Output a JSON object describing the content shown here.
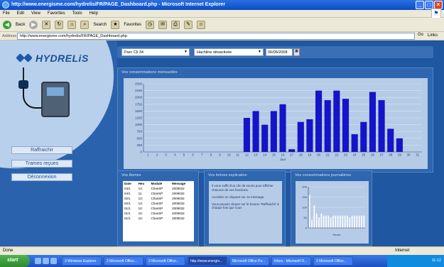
{
  "window": {
    "title": "http://www.energisme.com/hydrelis/FR/PAGE_Dashboard.php - Microsoft Internet Explorer"
  },
  "menu": [
    "File",
    "Edit",
    "View",
    "Favorites",
    "Tools",
    "Help"
  ],
  "toolbar": {
    "back": "Back",
    "search": "Search",
    "favorites": "Favorites"
  },
  "address": {
    "label": "Address",
    "url": "http://www.energisme.com/hydrelis/FR/PAGE_Dashboard.php",
    "go": "Go",
    "links": "Links"
  },
  "brand": {
    "name": "HYDRELiS"
  },
  "nav": [
    {
      "label": "Raffraichir"
    },
    {
      "label": "Trames reçues"
    },
    {
      "label": "Déconnexion"
    }
  ],
  "filters": {
    "site": "Parc Cli 34",
    "sensor": "Hachline désactivée",
    "date": "06/06/2008"
  },
  "panels": {
    "main_title": "Vos consommations mensuelles",
    "alerts_title": "Vos Alertes",
    "explain_title": "Vos brèves explication",
    "mini_title": "Vos consommations journalières"
  },
  "alerts": {
    "headers": [
      "Date",
      "Heu",
      "Module",
      "Message"
    ],
    "rows": [
      [
        "04/1",
        "13:",
        "ChanSP",
        "2009032"
      ],
      [
        "04/1",
        "11:",
        "ChanSP",
        "2009032"
      ],
      [
        "02/1",
        "13:",
        "ChanSP",
        "2009032"
      ],
      [
        "02/1",
        "13:",
        "ChanSP",
        "2009032"
      ],
      [
        "01/1",
        "10:",
        "ChanSP",
        "2009032"
      ],
      [
        "01/1",
        "10:",
        "ChanSP",
        "2009032"
      ],
      [
        "01/1",
        "10:",
        "ChanSP",
        "2009032"
      ]
    ]
  },
  "explain": {
    "paragraphs": [
      "Il vous suffit d'un clic de souris pour afficher chacune de vos fonctions.",
      "Accédez en cliquant sur ce message.",
      "Vous pouvez cliquer sur le bouton 'Raffraichir' à chaque fois que vous"
    ]
  },
  "chart_data": [
    {
      "type": "bar",
      "categories": [
        "1",
        "2",
        "3",
        "4",
        "5",
        "6",
        "7",
        "8",
        "9",
        "10",
        "11",
        "12",
        "13",
        "14",
        "15",
        "16",
        "17",
        "18",
        "19",
        "20",
        "21",
        "22",
        "23",
        "24",
        "25",
        "26",
        "27",
        "28",
        "29",
        "30",
        "31"
      ],
      "values": [
        0,
        0,
        0,
        0,
        0,
        0,
        0,
        0,
        0,
        0,
        0,
        1250,
        1500,
        1000,
        1500,
        1750,
        100,
        1100,
        1200,
        2250,
        1900,
        2250,
        1950,
        650,
        1100,
        2200,
        1900,
        850,
        500,
        0,
        0
      ],
      "ylim": [
        0,
        2500
      ],
      "yticks": [
        0,
        250,
        500,
        750,
        1000,
        1250,
        1500,
        1750,
        2000,
        2250,
        2500
      ],
      "xlabel": "Jour",
      "color": "#1414c8"
    },
    {
      "type": "bar",
      "categories": [
        "0",
        "1",
        "2",
        "3",
        "4",
        "5",
        "6",
        "7",
        "8",
        "9",
        "10",
        "11",
        "12",
        "13",
        "14",
        "15",
        "16",
        "17",
        "18",
        "19",
        "20",
        "21",
        "22",
        "23"
      ],
      "values": [
        160,
        40,
        110,
        70,
        50,
        70,
        60,
        60,
        60,
        50,
        60,
        60,
        60,
        60,
        60,
        60,
        60,
        50,
        60,
        60,
        60,
        60,
        60,
        60
      ],
      "ylim": [
        0,
        200
      ],
      "yticks": [
        0,
        50,
        100,
        150,
        200
      ],
      "xlabel": "Heure",
      "color": "#ffffff"
    }
  ],
  "statusbar": {
    "left": "Done",
    "right": "Internet"
  },
  "taskbar": {
    "start": "start",
    "items": [
      "3 Windows Explorer",
      "2 Microsoft Office...",
      "2 Microsoft Office...",
      "http://www.energis...",
      "Microsoft Office Po...",
      "Inbox - Microsoft O...",
      "2 Microsoft Office..."
    ],
    "clock": "11:12"
  }
}
